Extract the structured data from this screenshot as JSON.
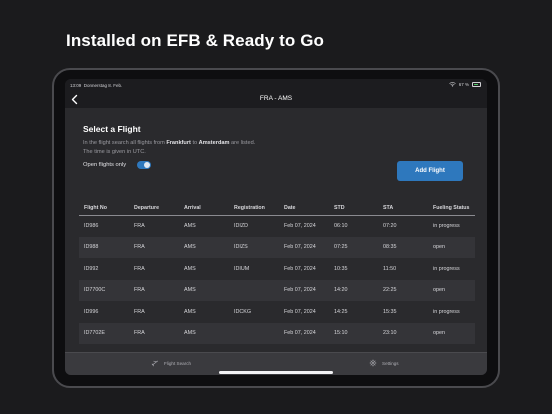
{
  "headline": "Installed on EFB & Ready to Go",
  "status": {
    "time": "13:09",
    "date": "Donnerstag 8. Feb.",
    "battery": "67 %",
    "battery_level": 0.67
  },
  "nav": {
    "title": "FRA - AMS",
    "back_icon": "chevron-left-icon"
  },
  "section": {
    "title": "Select a Flight",
    "desc_pre": "In the flight search all flights from ",
    "origin": "Frankfurt",
    "desc_mid": " to ",
    "destination": "Amsterdam",
    "desc_post": " are listed.",
    "desc_line2": "The time is given in UTC."
  },
  "filter": {
    "label": "Open flights only",
    "on": true
  },
  "add_button": "Add Flight",
  "table": {
    "headers": [
      "Flight No",
      "Departure",
      "Arrival",
      "Registration",
      "Date",
      "STD",
      "STA",
      "Fueling Status"
    ],
    "rows": [
      [
        "ID986",
        "FRA",
        "AMS",
        "IDIZD",
        "Feb 07, 2024",
        "06:10",
        "07:20",
        "in progress"
      ],
      [
        "ID988",
        "FRA",
        "AMS",
        "IDIZS",
        "Feb 07, 2024",
        "07:25",
        "08:35",
        "open"
      ],
      [
        "ID992",
        "FRA",
        "AMS",
        "IDIUM",
        "Feb 07, 2024",
        "10:35",
        "11:50",
        "in progress"
      ],
      [
        "ID7700C",
        "FRA",
        "AMS",
        "",
        "Feb 07, 2024",
        "14:20",
        "22:25",
        "open"
      ],
      [
        "ID996",
        "FRA",
        "AMS",
        "IDCKG",
        "Feb 07, 2024",
        "14:25",
        "15:35",
        "in progress"
      ],
      [
        "ID7702E",
        "FRA",
        "AMS",
        "",
        "Feb 07, 2024",
        "15:10",
        "23:10",
        "open"
      ]
    ]
  },
  "tabs": [
    {
      "label": "Flight Search",
      "icon": "airplane-icon"
    },
    {
      "label": "Settings",
      "icon": "gear-icon"
    }
  ],
  "colors": {
    "accent": "#2e78bd",
    "background": "#1b1b1d",
    "screen": "#2a2a2d"
  }
}
